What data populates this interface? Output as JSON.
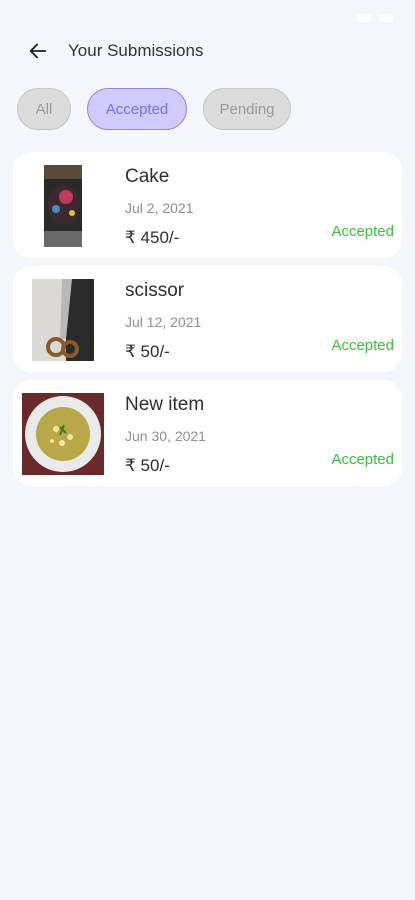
{
  "header": {
    "title": "Your Submissions"
  },
  "filters": [
    {
      "label": "All"
    },
    {
      "label": "Accepted",
      "selected": true
    },
    {
      "label": "Pending"
    }
  ],
  "colors": {
    "accent": "#7b6ff0",
    "accent_bg": "#cfcbfb",
    "status_accepted": "#3bbf3b",
    "background": "#f4f6fb"
  },
  "submissions": [
    {
      "name": "Cake",
      "date": "Jul 2, 2021",
      "price": "₹ 450/-",
      "status": "Accepted",
      "image": "cake-photo"
    },
    {
      "name": "scissor",
      "date": "Jul 12, 2021",
      "price": "₹ 50/-",
      "status": "Accepted",
      "image": "scissor-photo"
    },
    {
      "name": "New item",
      "date": "Jun 30, 2021",
      "price": "₹ 50/-",
      "status": "Accepted",
      "image": "soup-photo"
    }
  ]
}
